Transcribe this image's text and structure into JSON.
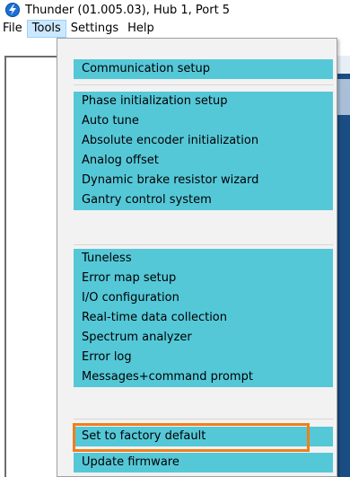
{
  "window": {
    "title": "Thunder (01.005.03), Hub 1, Port 5",
    "icon": "thunder-app-icon"
  },
  "menubar": {
    "items": [
      {
        "label": "File"
      },
      {
        "label": "Tools",
        "active": true
      },
      {
        "label": "Settings"
      },
      {
        "label": "Help"
      }
    ]
  },
  "tools_menu": {
    "groups": [
      [
        "Communication setup"
      ],
      [
        "Phase initialization setup",
        "Auto tune",
        "Absolute encoder initialization",
        "Analog offset",
        "Dynamic brake resistor wizard",
        "Gantry control system"
      ],
      [
        "Tuneless",
        "Error map setup",
        "I/O configuration",
        "Real-time data collection",
        "Spectrum analyzer",
        "Error log",
        "Messages+command prompt"
      ],
      [
        "Set to factory default",
        "Update firmware"
      ]
    ],
    "highlighted_item": "Set to factory default",
    "colors": {
      "item_background": "#55c8d8",
      "highlight_border": "#f07f1a",
      "menubar_active": "#cce8ff"
    }
  }
}
